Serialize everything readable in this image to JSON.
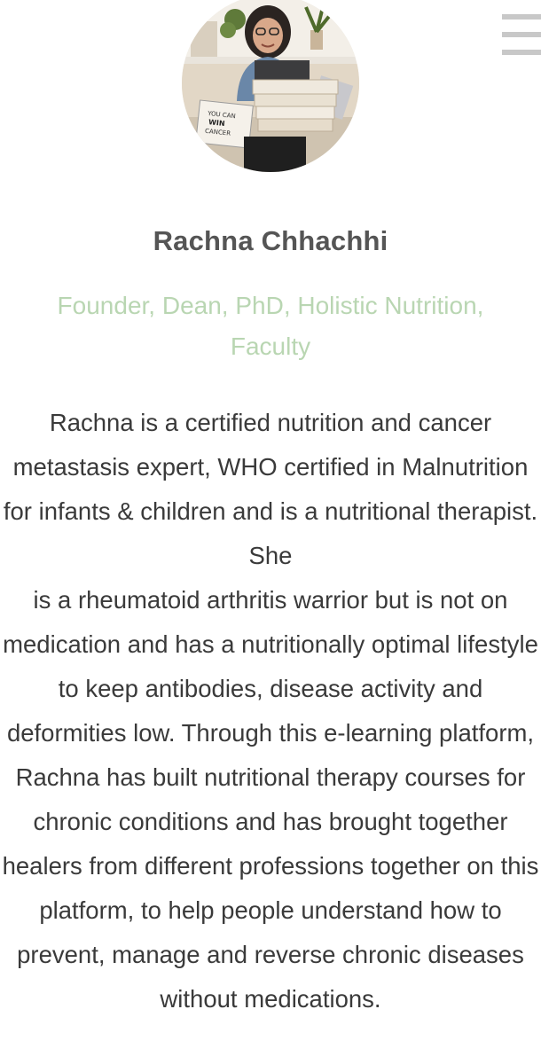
{
  "profile": {
    "name": "Rachna Chhachhi",
    "role": "Founder, Dean, PhD, Holistic Nutrition, Faculty",
    "bio": "Rachna is a certified nutrition and cancer metastasis expert, WHO certified in Malnutrition for infants & children and is a nutritional therapist. She\nis a rheumatoid arthritis warrior but is not on medication and has a nutritionally optimal lifestyle to keep antibodies, disease activity and deformities low. Through this e-learning platform, Rachna has built nutritional therapy courses for chronic conditions and has brought together healers from different professions together on this platform, to help people understand how to  prevent, manage and reverse chronic diseases without medications.",
    "photo_book_text": "YOU CAN WIN CANCER"
  },
  "header": {
    "menu_icon": "hamburger-menu-icon"
  },
  "colors": {
    "name": "#555555",
    "role": "#b9d6b2",
    "bio": "#3a3a3a",
    "menu": "#c8c8c8"
  }
}
